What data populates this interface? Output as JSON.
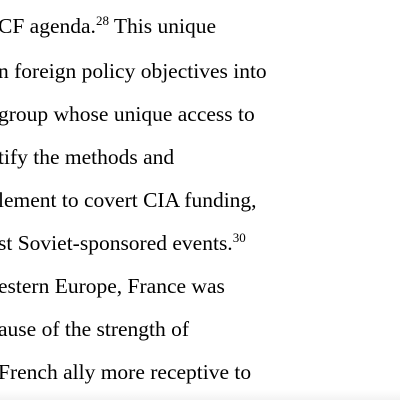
{
  "document": {
    "lines": [
      {
        "text": "CF agenda.",
        "sup": "28",
        "after": " This unique"
      },
      {
        "text": "n foreign policy objectives into",
        "sup": "",
        "after": ""
      },
      {
        "text": "group whose unique access to",
        "sup": "",
        "after": ""
      },
      {
        "text": "tify the methods and",
        "sup": "",
        "after": ""
      },
      {
        "text": "lement to covert CIA funding,",
        "sup": "",
        "after": ""
      },
      {
        "text": "st Soviet-sponsored events.",
        "sup": "30",
        "after": ""
      },
      {
        "text": "estern Europe, France was",
        "sup": "",
        "after": ""
      },
      {
        "text": "ause of the strength of",
        "sup": "",
        "after": ""
      },
      {
        "text": " French ally more receptive to",
        "sup": "",
        "after": ""
      }
    ]
  }
}
